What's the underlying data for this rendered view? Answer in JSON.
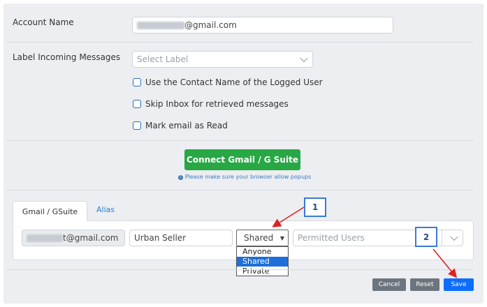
{
  "account": {
    "label": "Account Name",
    "email_suffix": "@gmail.com"
  },
  "label_incoming": {
    "label": "Label Incoming Messages",
    "placeholder": "Select Label"
  },
  "options": [
    {
      "label": "Use the Contact Name of the Logged User",
      "checked": false
    },
    {
      "label": "Skip Inbox for retrieved messages",
      "checked": false
    },
    {
      "label": "Mark email as Read",
      "checked": false
    }
  ],
  "connect_button": "Connect Gmail / G Suite",
  "popup_note": "Please make sure your browser allow popups",
  "tabs": [
    {
      "label": "Gmail / GSuite",
      "active": true
    },
    {
      "label": "Alias",
      "active": false
    }
  ],
  "alias_row": {
    "email_suffix": "t@gmail.com",
    "name_value": "Urban Seller",
    "sharing_value": "Shared",
    "permitted_placeholder": "Permitted Users"
  },
  "sharing_options": [
    "Anyone",
    "Shared",
    "Private"
  ],
  "sharing_selected": "Shared",
  "footer": {
    "cancel": "Cancel",
    "reset": "Reset",
    "save": "Save"
  },
  "callouts": [
    "1",
    "2"
  ],
  "colors": {
    "primary": "#0d6efd",
    "success": "#28a745",
    "secondary": "#6c757d",
    "annotation_arrow": "#e02020"
  }
}
